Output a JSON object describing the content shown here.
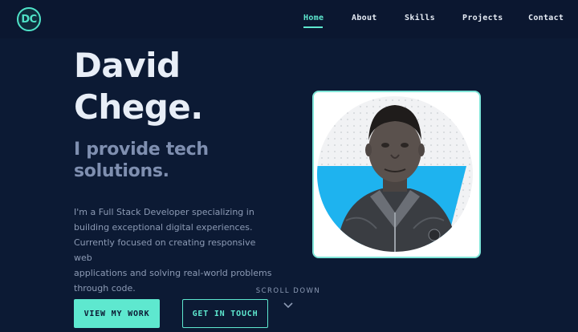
{
  "nav": {
    "logo": "DC",
    "links": [
      "Home",
      "About",
      "Skills",
      "Projects",
      "Contact"
    ],
    "active": "Home"
  },
  "hero": {
    "name_line1": "David",
    "name_line2": "Chege.",
    "tagline_line1": "I provide tech",
    "tagline_line2": "solutions.",
    "bio_lines": [
      "I'm a Full Stack Developer specializing in",
      "building exceptional digital experiences.",
      "Currently focused on creating responsive web",
      "applications and solving real-world problems",
      "through code."
    ],
    "primary_button": "VIEW MY WORK",
    "secondary_button": "GET IN TOUCH",
    "scroll_label": "SCROLL DOWN"
  },
  "colors": {
    "background": "#0c1a34",
    "accent": "#5ee8cf",
    "heading": "#e8eef7",
    "muted": "#7f8fb0",
    "photo_band": "#1eb3ef"
  },
  "icons": {
    "scroll": "chevron-down-icon",
    "photo": "profile-photo"
  }
}
